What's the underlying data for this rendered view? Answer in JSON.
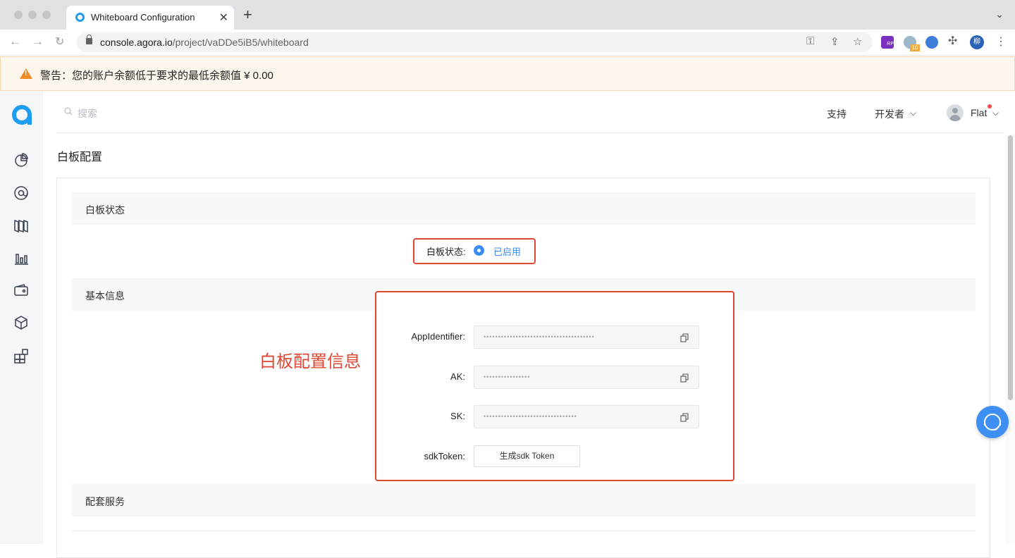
{
  "browser": {
    "tab_title": "Whiteboard Configuration",
    "url_host": "console.agora.io",
    "url_path": "/project/vaDDe5iB5/whiteboard",
    "profile_initial": "柳",
    "extension_badge": "10",
    "extension_rp_label": "RP"
  },
  "warning": {
    "text": "警告：您的账户余额低于要求的最低余额值 ¥ 0.00"
  },
  "header": {
    "search_placeholder": "搜索",
    "support": "支持",
    "developer": "开发者",
    "user_name": "Flat"
  },
  "page": {
    "title": "白板配置"
  },
  "sections": {
    "status_title": "白板状态",
    "basic_info_title": "基本信息",
    "services_title": "配套服务"
  },
  "status": {
    "label": "白板状态:",
    "value": "已启用"
  },
  "fields": {
    "app_identifier_label": "AppIdentifier:",
    "app_identifier_mask": "••••••••••••••••••••••••••••••••••••••",
    "ak_label": "AK:",
    "ak_mask": "••••••••••••••••",
    "sk_label": "SK:",
    "sk_mask": "••••••••••••••••••••••••••••••••",
    "sdk_token_label": "sdkToken:",
    "sdk_token_button": "生成sdk Token"
  },
  "annotation": {
    "text": "白板配置信息",
    "color": "#dd4733"
  },
  "colors": {
    "accent": "#3b8cf0",
    "brand": "#1a9df2",
    "warning_bg": "#fdf6ec"
  }
}
